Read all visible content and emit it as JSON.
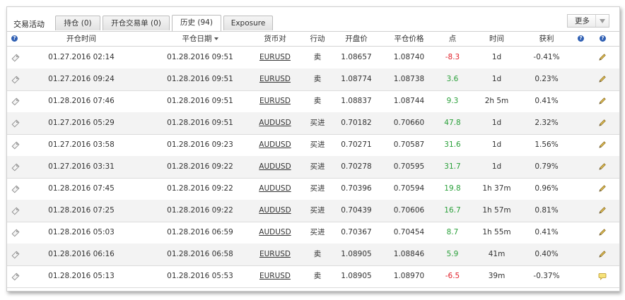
{
  "tabs": {
    "heading": "交易活动",
    "items": [
      {
        "label": "持仓 (0)"
      },
      {
        "label": "开仓交易单 (0)"
      },
      {
        "label": "历史 (94)"
      },
      {
        "label": "Exposure"
      }
    ],
    "active_index": 2,
    "more_label": "更多"
  },
  "columns": {
    "help_icon": "?",
    "open_time": "开仓时间",
    "close_date": "平仓日期",
    "pair": "货币对",
    "action": "行动",
    "open_price": "开盘价",
    "close_price": "平仓价格",
    "pips": "点",
    "duration": "时间",
    "profit": "获利"
  },
  "rows": [
    {
      "open_time": "01.27.2016 02:14",
      "close_date": "01.28.2016 09:51",
      "pair": "EURUSD",
      "action": "卖",
      "open_price": "1.08657",
      "close_price": "1.08740",
      "pips": "-8.3",
      "duration": "1d",
      "profit": "-0.41%",
      "end_icon": "pencil-icon"
    },
    {
      "open_time": "01.27.2016 09:24",
      "close_date": "01.28.2016 09:51",
      "pair": "EURUSD",
      "action": "卖",
      "open_price": "1.08774",
      "close_price": "1.08738",
      "pips": "3.6",
      "duration": "1d",
      "profit": "0.23%",
      "end_icon": "pencil-icon"
    },
    {
      "open_time": "01.28.2016 07:46",
      "close_date": "01.28.2016 09:51",
      "pair": "EURUSD",
      "action": "卖",
      "open_price": "1.08837",
      "close_price": "1.08744",
      "pips": "9.3",
      "duration": "2h 5m",
      "profit": "0.41%",
      "end_icon": "pencil-icon"
    },
    {
      "open_time": "01.27.2016 05:29",
      "close_date": "01.28.2016 09:51",
      "pair": "AUDUSD",
      "action": "买进",
      "open_price": "0.70182",
      "close_price": "0.70660",
      "pips": "47.8",
      "duration": "1d",
      "profit": "2.32%",
      "end_icon": "pencil-icon"
    },
    {
      "open_time": "01.27.2016 03:58",
      "close_date": "01.28.2016 09:23",
      "pair": "AUDUSD",
      "action": "买进",
      "open_price": "0.70271",
      "close_price": "0.70587",
      "pips": "31.6",
      "duration": "1d",
      "profit": "1.56%",
      "end_icon": "pencil-icon"
    },
    {
      "open_time": "01.27.2016 03:31",
      "close_date": "01.28.2016 09:22",
      "pair": "AUDUSD",
      "action": "买进",
      "open_price": "0.70278",
      "close_price": "0.70595",
      "pips": "31.7",
      "duration": "1d",
      "profit": "0.79%",
      "end_icon": "pencil-icon"
    },
    {
      "open_time": "01.28.2016 07:45",
      "close_date": "01.28.2016 09:22",
      "pair": "AUDUSD",
      "action": "买进",
      "open_price": "0.70396",
      "close_price": "0.70594",
      "pips": "19.8",
      "duration": "1h 37m",
      "profit": "0.96%",
      "end_icon": "pencil-icon"
    },
    {
      "open_time": "01.28.2016 07:25",
      "close_date": "01.28.2016 09:22",
      "pair": "AUDUSD",
      "action": "买进",
      "open_price": "0.70439",
      "close_price": "0.70606",
      "pips": "16.7",
      "duration": "1h 57m",
      "profit": "0.81%",
      "end_icon": "pencil-icon"
    },
    {
      "open_time": "01.28.2016 05:03",
      "close_date": "01.28.2016 06:59",
      "pair": "AUDUSD",
      "action": "买进",
      "open_price": "0.70367",
      "close_price": "0.70454",
      "pips": "8.7",
      "duration": "1h 55m",
      "profit": "0.41%",
      "end_icon": "pencil-icon"
    },
    {
      "open_time": "01.28.2016 06:16",
      "close_date": "01.28.2016 06:58",
      "pair": "EURUSD",
      "action": "卖",
      "open_price": "1.08905",
      "close_price": "1.08846",
      "pips": "5.9",
      "duration": "41m",
      "profit": "0.40%",
      "end_icon": "pencil-icon"
    },
    {
      "open_time": "01.28.2016 05:13",
      "close_date": "01.28.2016 05:53",
      "pair": "EURUSD",
      "action": "卖",
      "open_price": "1.08905",
      "close_price": "1.08970",
      "pips": "-6.5",
      "duration": "39m",
      "profit": "-0.37%",
      "end_icon": "comment-icon"
    }
  ],
  "colors": {
    "negative": "#e0202a",
    "positive": "#2aa03a",
    "help_icon": "#2f5fb3"
  }
}
